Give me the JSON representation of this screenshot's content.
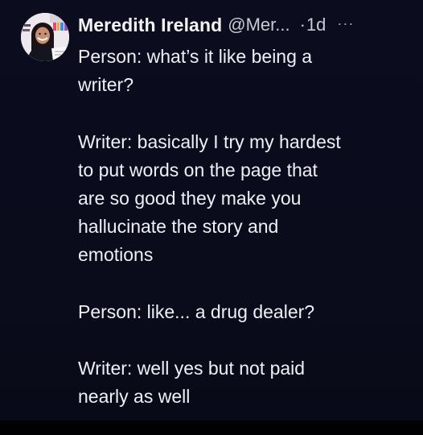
{
  "tweet": {
    "author": {
      "name": "Meredith Ireland",
      "handle": "@Mer...",
      "avatar_icon": "profile-photo"
    },
    "separator": "·",
    "time": "1d",
    "more_icon": "···",
    "lines": [
      "Person: what’s it like being a",
      "writer?",
      "",
      "Writer: basically I try my hardest",
      "to put words on the page that",
      "are so good they make you",
      "hallucinate the story and",
      "emotions",
      "",
      "Person: like... a drug dealer?",
      "",
      "Writer: well yes but not paid",
      "nearly as well"
    ]
  },
  "colors": {
    "background": "#0a0c1c",
    "text": "#eef0f5",
    "secondary_text": "#c9cad3"
  }
}
